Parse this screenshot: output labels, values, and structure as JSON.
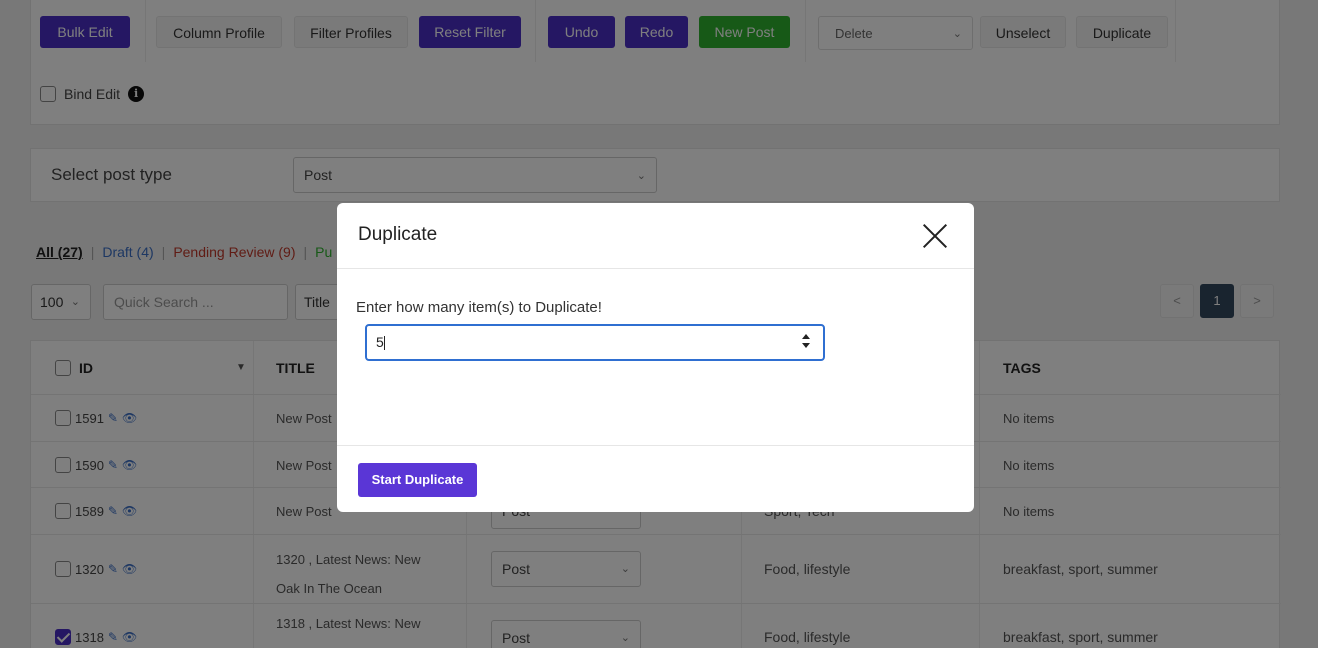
{
  "toolbar": {
    "bulk_edit": "Bulk Edit",
    "column_profile": "Column Profile",
    "filter_profiles": "Filter Profiles",
    "reset_filter": "Reset Filter",
    "undo": "Undo",
    "redo": "Redo",
    "new_post": "New Post",
    "action_select": "Delete",
    "unselect": "Unselect",
    "duplicate": "Duplicate",
    "bind_edit": "Bind Edit"
  },
  "post_type": {
    "label": "Select post type",
    "value": "Post"
  },
  "status_filters": [
    {
      "label": "All (27)"
    },
    {
      "label": "Draft (4)"
    },
    {
      "label": "Pending Review (9)"
    },
    {
      "label": "Pu"
    }
  ],
  "search": {
    "per_page": "100",
    "quick_search_placeholder": "Quick Search ...",
    "column": "Title"
  },
  "pagination": {
    "prev": "<",
    "current": "1",
    "next": ">"
  },
  "table": {
    "headers": {
      "id": "ID",
      "title": "TITLE",
      "tags": "TAGS"
    },
    "rows": [
      {
        "id": "1591",
        "title": "New Post",
        "type": "",
        "categories": "",
        "tags": "No items",
        "checked": false
      },
      {
        "id": "1590",
        "title": "New Post",
        "type": "",
        "categories": "",
        "tags": "No items",
        "checked": false
      },
      {
        "id": "1589",
        "title": "New Post",
        "type": "Post",
        "categories": "Sport, Tech",
        "tags": "No items",
        "checked": false
      },
      {
        "id": "1320",
        "title": "1320 , Latest News: New Oak In The Ocean",
        "type": "Post",
        "categories": "Food, lifestyle",
        "tags": "breakfast, sport, summer",
        "checked": false
      },
      {
        "id": "1318",
        "title": "1318 , Latest News: New",
        "type": "Post",
        "categories": "Food, lifestyle",
        "tags": "breakfast, sport, summer",
        "checked": true
      }
    ]
  },
  "modal": {
    "title": "Duplicate",
    "prompt": "Enter how many item(s) to Duplicate!",
    "input_value": "5",
    "start_button": "Start Duplicate"
  },
  "colors": {
    "primary_purple": "#4a2fc7",
    "start_button": "#5a36d6",
    "new_post_green": "#2fb22f",
    "input_focus": "#2f6fd1"
  }
}
